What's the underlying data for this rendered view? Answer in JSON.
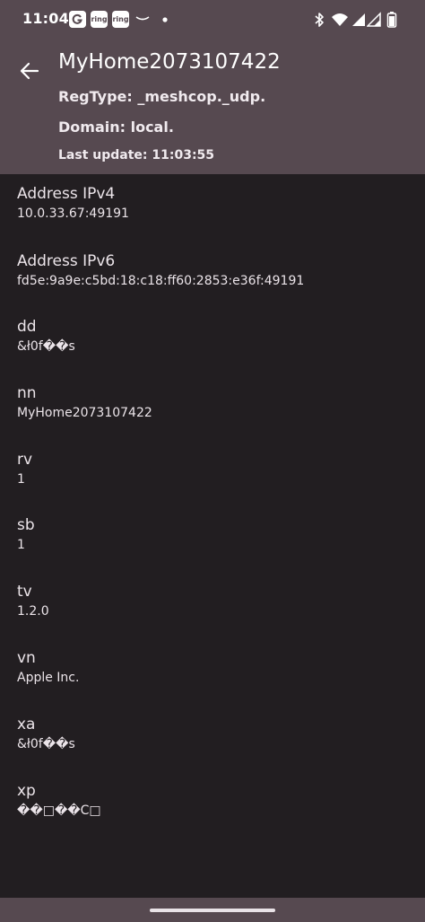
{
  "status_bar": {
    "time": "11:04",
    "notification_icons": [
      "google-icon",
      "ring-icon",
      "ring-icon",
      "amazon-icon",
      "dot-icon"
    ],
    "ring_label": "ring",
    "system_icons": [
      "bluetooth-icon",
      "wifi-icon",
      "signal-icon",
      "signal-icon",
      "battery-icon"
    ]
  },
  "header": {
    "title": "MyHome2073107422",
    "reg_type": "RegType: _meshcop._udp.",
    "domain": "Domain: local.",
    "last_update": "Last update: 11:03:55"
  },
  "attributes": [
    {
      "key": "Address IPv4",
      "value": "10.0.33.67:49191"
    },
    {
      "key": "Address IPv6",
      "value": "fd5e:9a9e:c5bd:18:c18:ff60:2853:e36f:49191"
    },
    {
      "key": "dd",
      "value": "&ł0f��s"
    },
    {
      "key": "nn",
      "value": "MyHome2073107422"
    },
    {
      "key": "rv",
      "value": "1"
    },
    {
      "key": "sb",
      "value": "1"
    },
    {
      "key": "tv",
      "value": "1.2.0"
    },
    {
      "key": "vn",
      "value": "Apple Inc."
    },
    {
      "key": "xa",
      "value": "&ł0f��s"
    },
    {
      "key": "xp",
      "value": "��□��C□"
    }
  ],
  "colors": {
    "app_bar": "#564950",
    "background": "#221e21",
    "text": "#e8e1e6"
  }
}
